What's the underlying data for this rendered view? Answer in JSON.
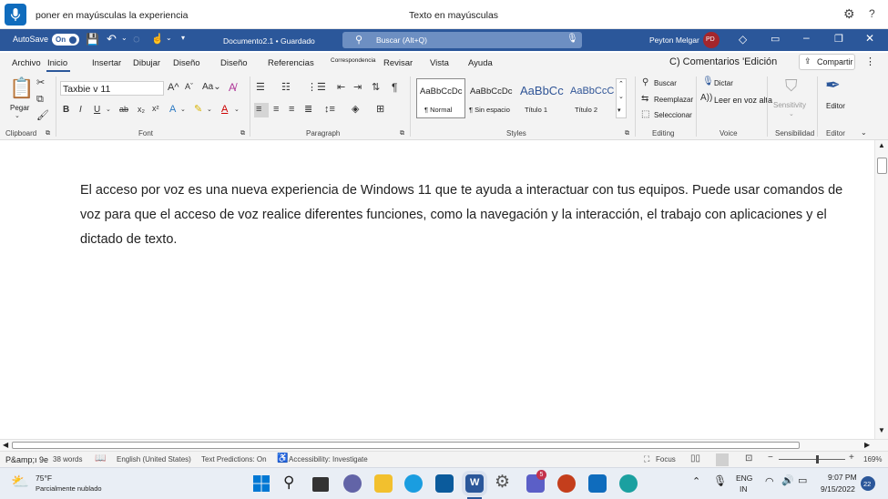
{
  "voice_bar": {
    "command_text": "poner en mayúsculas la experiencia",
    "status_text": "Texto en mayúsculas"
  },
  "titlebar": {
    "autosave_label": "AutoSave",
    "autosave_state": "On",
    "document_title": "Documento2.1 • Guardado",
    "search_placeholder": "Buscar (Alt+Q)",
    "user_name": "Peyton Melgar",
    "user_initials": "PD"
  },
  "tabs": [
    "Archivo",
    "Inicio",
    "Insertar",
    "Dibujar",
    "Diseño",
    "Diseño",
    "Referencias",
    "Correspondencia",
    "Revisar",
    "Vista",
    "Ayuda"
  ],
  "active_tab": "Inicio",
  "comments_label": "C) Comentarios 'Edición",
  "share_label": "Compartir",
  "ribbon": {
    "clipboard": {
      "paste": "Pegar",
      "label": "Clipboard"
    },
    "font": {
      "name": "Taxbie v 11",
      "label": "Font"
    },
    "paragraph": {
      "label": "Paragraph"
    },
    "styles": {
      "label": "Styles",
      "items": [
        {
          "preview": "AaBbCcDc",
          "name": "¶ Normal"
        },
        {
          "preview": "AaBbCcDc",
          "name": "¶ Sin espacio"
        },
        {
          "preview": "AaBbCc",
          "name": "Título 1"
        },
        {
          "preview": "AaBbCcC",
          "name": "Título 2"
        }
      ]
    },
    "editing": {
      "find": "Buscar",
      "replace": "Reemplazar",
      "select": "Seleccionar",
      "label": "Editing"
    },
    "voice": {
      "dictate": "Dictar",
      "read_aloud": "Leer en voz alta",
      "label": "Voice"
    },
    "sensitivity": {
      "button": "Sensitivity",
      "label": "Sensibilidad"
    },
    "editor": {
      "button": "Editor",
      "label": "Editor"
    }
  },
  "document": {
    "text": "El acceso por voz es una nueva experiencia de Windows 11 que te ayuda a interactuar con tus equipos. Puede usar comandos de voz para que el acceso de voz realice diferentes funciones, como la navegación y la interacción, el trabajo con aplicaciones y el dictado de texto."
  },
  "status_bar": {
    "page": "P&amp;ı 9e",
    "words": "38 words",
    "language": "English (United States)",
    "predictions": "Text Predictions: On",
    "accessibility": "Accessibility: Investigate",
    "focus": "Focus",
    "zoom": "169%"
  },
  "taskbar": {
    "temperature": "75°F",
    "weather": "Parcialmente nublado",
    "lang_1": "ENG",
    "lang_2": "IN",
    "time": "9:07 PM",
    "date": "9/15/2022",
    "notifications": "22",
    "teams_badge": "5"
  }
}
